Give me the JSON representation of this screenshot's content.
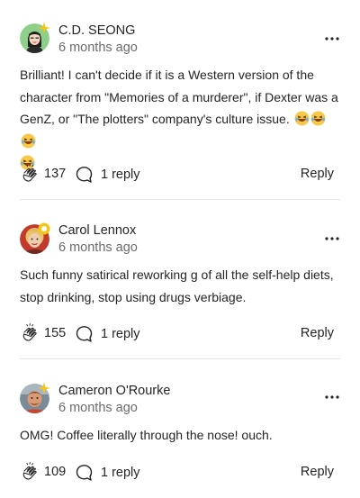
{
  "comments": [
    {
      "author": "C.D. SEONG",
      "time": "6 months ago",
      "text": "Brilliant! I can't decide if it is a Western version of the character from \"Memories of a murderer\", if Dexter was a GenZ, or \"The plotters\" company's culture issue.",
      "emojis": [
        "😂",
        "😂",
        "😂",
        "😂"
      ],
      "claps": "137",
      "replies": "1 reply",
      "reply_label": "Reply",
      "badge_color": "#f5c518"
    },
    {
      "author": "Carol Lennox",
      "time": "6 months ago",
      "text": "Such funny satirical reworking g of all the self-help diets, stop drinking, stop using drugs verbiage.",
      "claps": "155",
      "replies": "1 reply",
      "reply_label": "Reply",
      "badge_color": "#f5c518"
    },
    {
      "author": "Cameron O'Rourke",
      "time": "6 months ago",
      "text": "OMG! Coffee literally through the nose! ouch.",
      "claps": "109",
      "replies": "1 reply",
      "reply_label": "Reply",
      "badge_color": "#f5c518"
    }
  ],
  "icons": {
    "clap": "clap-icon",
    "reply": "speech-bubble-icon",
    "more": "more-horizontal-icon"
  }
}
